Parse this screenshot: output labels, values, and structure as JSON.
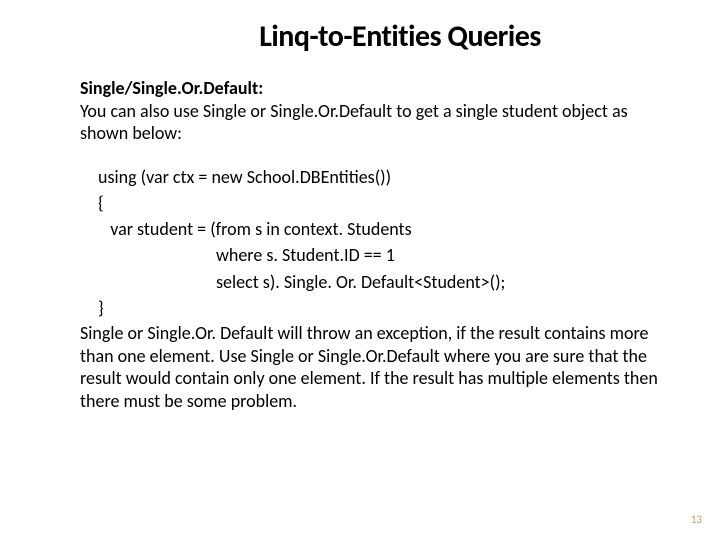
{
  "title": "Linq-to-Entities Queries",
  "subhead": "Single/Single.Or.Default:",
  "para1": "You can also use Single or Single.Or.Default to get a single student object as shown below:",
  "code": {
    "l1": "using (var ctx = new School.DBEntities())",
    "l2": "{",
    "l3": "   var student = (from s in context. Students",
    "l4": "                             where s. Student.ID == 1",
    "l5": "                             select s). Single. Or. Default<Student>();",
    "l6": "}"
  },
  "para2": "Single or Single.Or. Default will throw an exception, if the result contains more than one element. Use Single or Single.Or.Default where you are sure that the result would contain only one element. If the result has multiple elements then there must be some problem.",
  "pagenum": "13"
}
